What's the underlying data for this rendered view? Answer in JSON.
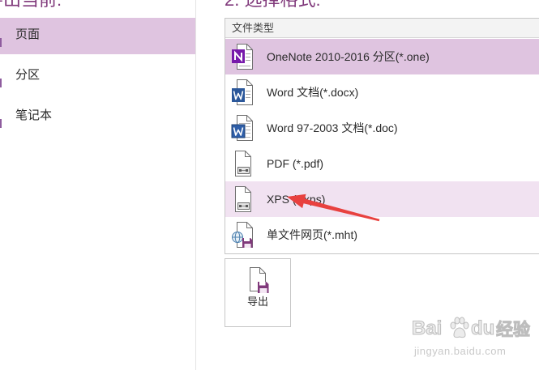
{
  "left_panel": {
    "heading": "导出当前:",
    "items": [
      {
        "label": "页面",
        "selected": true
      },
      {
        "label": "分区",
        "selected": false
      },
      {
        "label": "笔记本",
        "selected": false
      }
    ]
  },
  "right_panel": {
    "heading": "2. 选择格式:",
    "list_header": "文件类型",
    "formats": [
      {
        "label": "OneNote 2010-2016 分区(*.one)",
        "icon": "onenote-file-icon",
        "selected": true,
        "hovered": false
      },
      {
        "label": "Word 文档(*.docx)",
        "icon": "word-docx-file-icon",
        "selected": false,
        "hovered": false
      },
      {
        "label": "Word 97-2003 文档(*.doc)",
        "icon": "word-doc-file-icon",
        "selected": false,
        "hovered": false
      },
      {
        "label": "PDF (*.pdf)",
        "icon": "pdf-file-icon",
        "selected": false,
        "hovered": false
      },
      {
        "label": "XPS (*.xps)",
        "icon": "xps-file-icon",
        "selected": false,
        "hovered": true
      },
      {
        "label": "单文件网页(*.mht)",
        "icon": "mht-file-icon",
        "selected": false,
        "hovered": false
      }
    ],
    "export_button": {
      "label": "导出",
      "icon": "export-save-icon"
    }
  },
  "annotation": {
    "icon": "red-arrow-icon"
  },
  "watermark": {
    "logo_part1": "Bai",
    "logo_part2": "du",
    "logo_cn": "经验",
    "url": "jingyan.baidu.com",
    "icon": "paw-icon"
  },
  "colors": {
    "accent": "#80397b",
    "selected_background": "#dfc4e0",
    "hover_background": "#f1e2f1",
    "annotation_arrow": "#e8413f",
    "onenote_purple": "#7719aa",
    "word_blue": "#2b579a"
  }
}
